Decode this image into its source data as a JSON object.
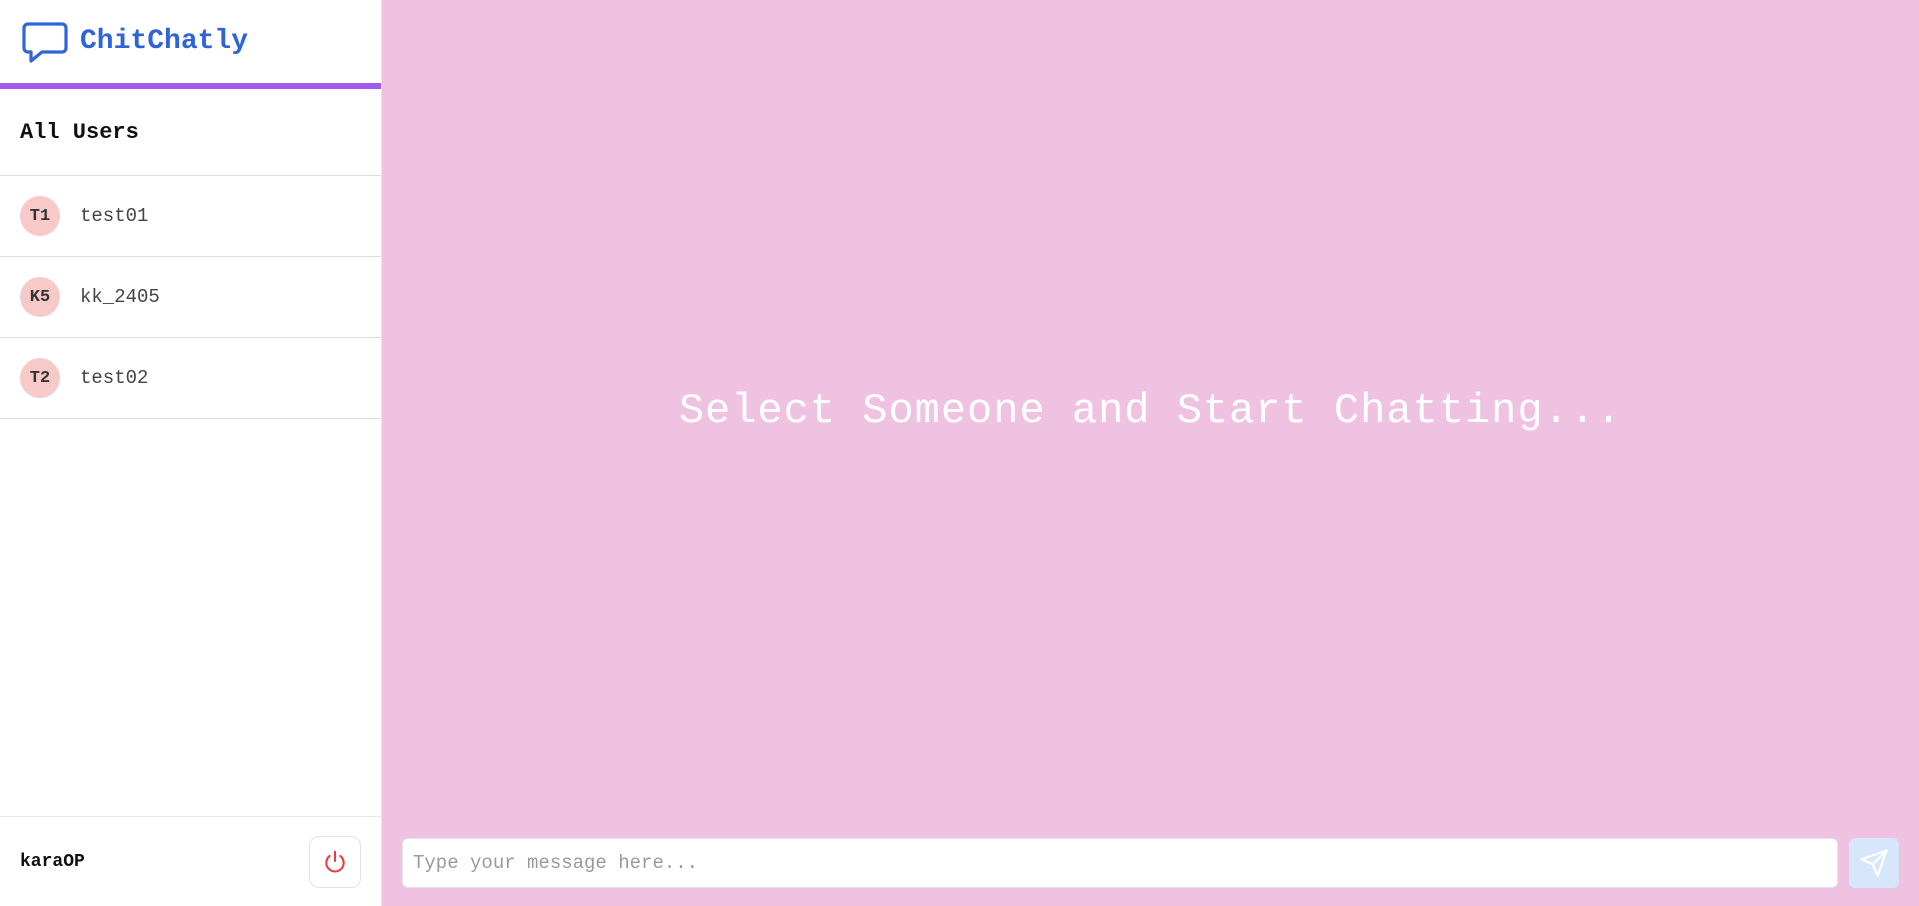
{
  "brand": {
    "name": "ChitChatly",
    "icon": "chat-bubble-icon",
    "color": "#2f63d8"
  },
  "sidebar": {
    "section_title": "All Users",
    "users": [
      {
        "initials": "T1",
        "name": "test01"
      },
      {
        "initials": "K5",
        "name": "kk_2405"
      },
      {
        "initials": "T2",
        "name": "test02"
      }
    ],
    "current_user": "karaOP",
    "logout_icon": "power-icon"
  },
  "main": {
    "placeholder": "Select Someone and Start Chatting...",
    "background": "#efc2e1"
  },
  "composer": {
    "input_placeholder": "Type your message here...",
    "send_icon": "send-icon"
  },
  "colors": {
    "accent_bar": "#a259ee",
    "avatar_bg": "#f8c9c9",
    "logout_icon": "#e0444a",
    "send_button_bg": "#d6e6fb"
  }
}
